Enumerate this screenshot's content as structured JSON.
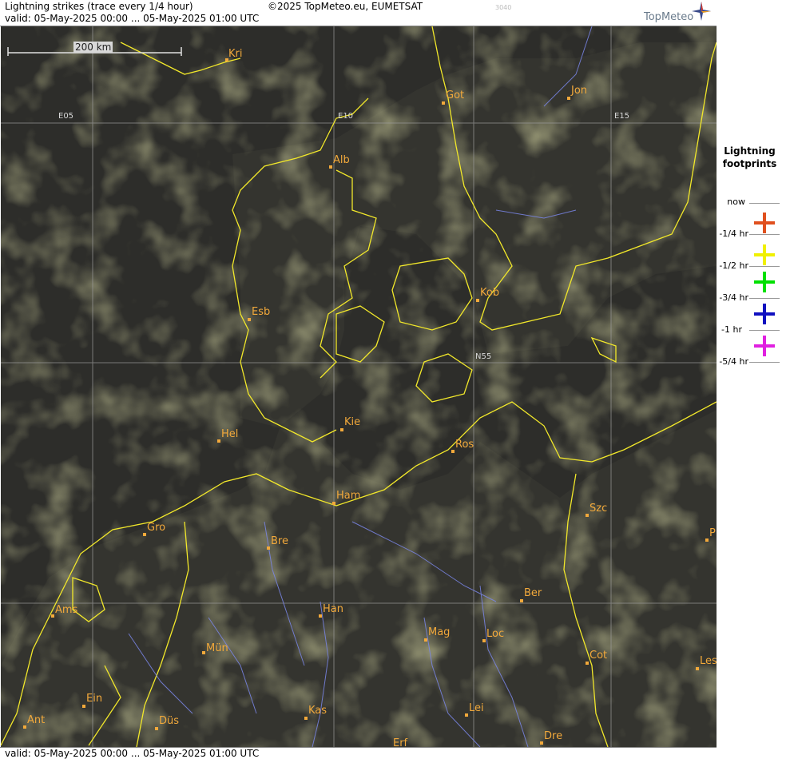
{
  "header": {
    "title": "Lightning strikes (trace every 1/4 hour)",
    "valid": "valid:  05-May-2025 00:00 ... 05-May-2025 01:00 UTC",
    "copyright": "©2025 TopMeteo.eu, EUMETSAT",
    "image_id": "3040",
    "logo": "TopMeteo"
  },
  "footer": {
    "valid": "valid:  05-May-2025 00:00 ... 05-May-2025 01:00 UTC"
  },
  "scale": {
    "label": "200 km"
  },
  "grid_labels": {
    "e05": "E05",
    "e10": "E10",
    "e15": "E15",
    "n55": "N55"
  },
  "cities": [
    {
      "id": "kri",
      "name": "Kri"
    },
    {
      "id": "got",
      "name": "Got"
    },
    {
      "id": "jon",
      "name": "Jon"
    },
    {
      "id": "alb",
      "name": "Alb"
    },
    {
      "id": "kob",
      "name": "Kob"
    },
    {
      "id": "esb",
      "name": "Esb"
    },
    {
      "id": "kie",
      "name": "Kie"
    },
    {
      "id": "hel",
      "name": "Hel"
    },
    {
      "id": "ros",
      "name": "Ros"
    },
    {
      "id": "ham",
      "name": "Ham"
    },
    {
      "id": "szc",
      "name": "Szc"
    },
    {
      "id": "gro",
      "name": "Gro"
    },
    {
      "id": "bre",
      "name": "Bre"
    },
    {
      "id": "p",
      "name": "P"
    },
    {
      "id": "ber",
      "name": "Ber"
    },
    {
      "id": "ams",
      "name": "Ams"
    },
    {
      "id": "han",
      "name": "Han"
    },
    {
      "id": "mag",
      "name": "Mag"
    },
    {
      "id": "loc",
      "name": "Loc"
    },
    {
      "id": "mun",
      "name": "Mün"
    },
    {
      "id": "cot",
      "name": "Cot"
    },
    {
      "id": "les",
      "name": "Les"
    },
    {
      "id": "ein",
      "name": "Ein"
    },
    {
      "id": "kas",
      "name": "Kas"
    },
    {
      "id": "lei",
      "name": "Lei"
    },
    {
      "id": "ant",
      "name": "Ant"
    },
    {
      "id": "dus",
      "name": "Düs"
    },
    {
      "id": "dre",
      "name": "Dre"
    },
    {
      "id": "erf",
      "name": "Erf"
    }
  ],
  "legend": {
    "title_line1": "Lightning",
    "title_line2": "footprints",
    "items": [
      {
        "label": "now",
        "color": ""
      },
      {
        "label": "-1/4 hr",
        "color": "#e0501e"
      },
      {
        "label": "-1/2 hr",
        "color": "#f0f000"
      },
      {
        "label": "-3/4 hr",
        "color": "#00e000"
      },
      {
        "label": "-1 hr",
        "color": "#1010c0"
      },
      {
        "label": "-5/4 hr",
        "color": "#e020e0"
      }
    ]
  },
  "colors": {
    "coastline": "#f2e82a",
    "rivers": "#7a86e8",
    "city_label": "#f2a93b",
    "grid": "#9a9a9a",
    "clouds": "#8a8a50"
  }
}
